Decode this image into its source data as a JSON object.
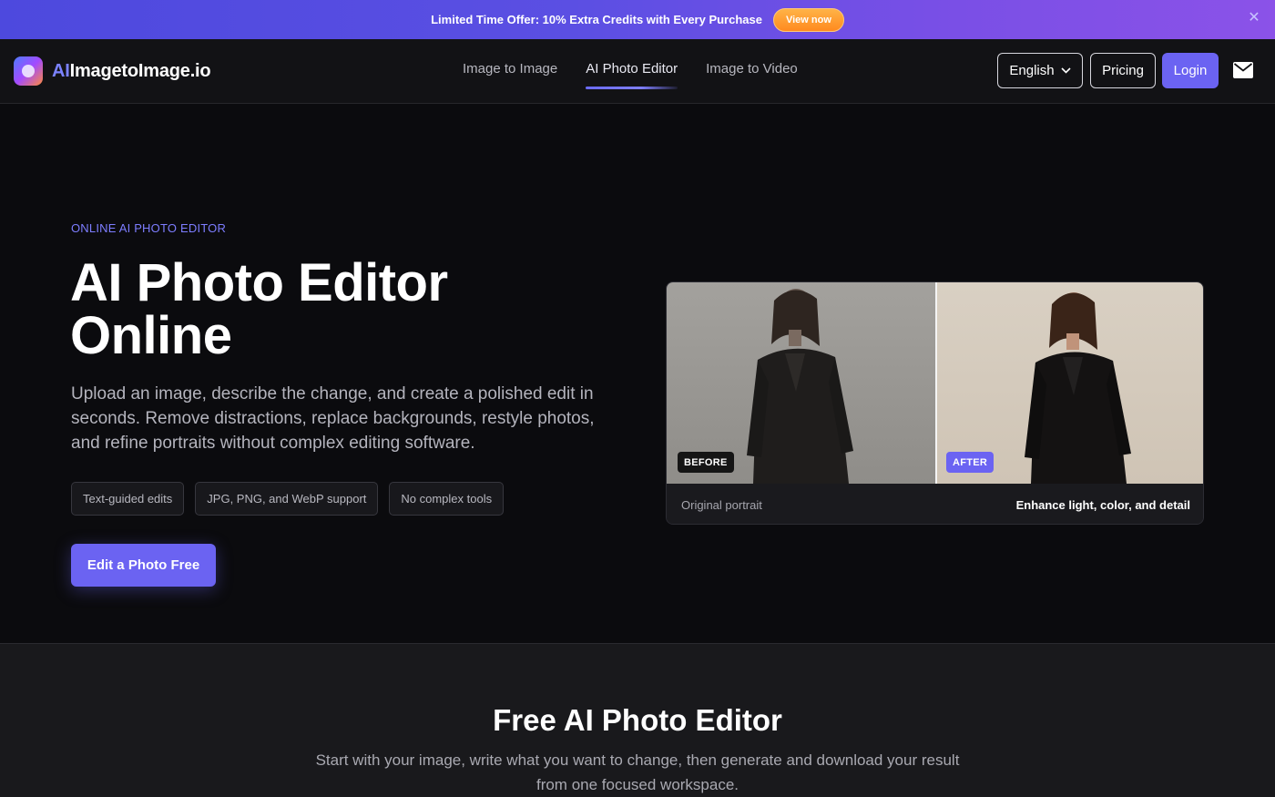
{
  "promo": {
    "text": "Limited Time Offer: 10% Extra Credits with Every Purchase",
    "button_label": "View now",
    "close_icon": "close-icon"
  },
  "header": {
    "logo": {
      "ai": "AI",
      "rest": "ImagetoImage.io"
    },
    "nav": [
      {
        "label": "Image to Image",
        "active": false
      },
      {
        "label": "AI Photo Editor",
        "active": true
      },
      {
        "label": "Image to Video",
        "active": false
      }
    ],
    "language_label": "English",
    "pricing_label": "Pricing",
    "login_label": "Login",
    "mail_icon": "mail-icon"
  },
  "hero": {
    "eyebrow": "ONLINE AI PHOTO EDITOR",
    "title_line1": "AI Photo Editor",
    "title_line2": "Online",
    "description": "Upload an image, describe the change, and create a polished edit in seconds. Remove distractions, replace backgrounds, restyle photos, and refine portraits without complex editing software.",
    "chips": [
      "Text-guided edits",
      "JPG, PNG, and WebP support",
      "No complex tools"
    ],
    "cta_label": "Edit a Photo Free"
  },
  "compare": {
    "before_label": "BEFORE",
    "after_label": "AFTER",
    "caption_left": "Original portrait",
    "caption_right": "Enhance light, color, and detail"
  },
  "section2": {
    "title": "Free AI Photo Editor",
    "description": "Start with your image, write what you want to change, then generate and download your result from one focused workspace."
  },
  "colors": {
    "accent": "#6b63f2",
    "eyebrow": "#7d7dff",
    "promo_button": "#ff8a1f"
  }
}
